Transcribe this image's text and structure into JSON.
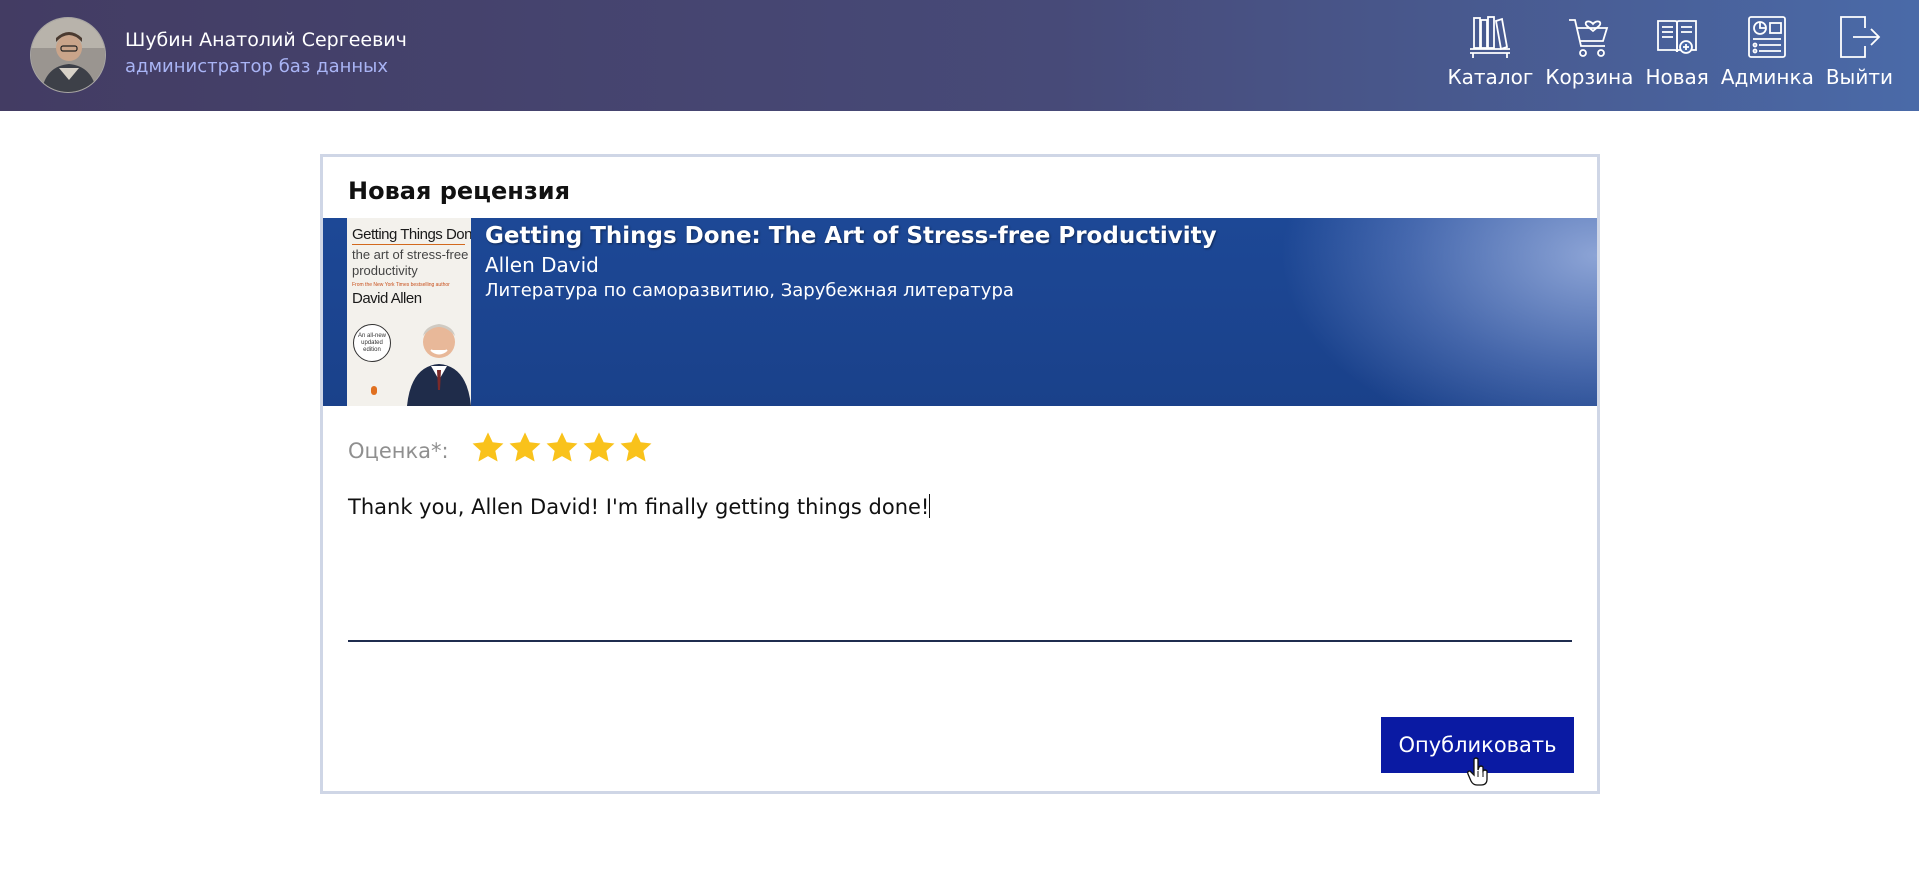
{
  "user": {
    "name": "Шубин Анатолий Сергеевич",
    "role": "администратор баз данных"
  },
  "nav": [
    {
      "label": "Каталог",
      "icon": "bookshelf-icon"
    },
    {
      "label": "Корзина",
      "icon": "cart-icon"
    },
    {
      "label": "Новая",
      "icon": "new-book-icon"
    },
    {
      "label": "Админка",
      "icon": "dashboard-icon"
    },
    {
      "label": "Выйти",
      "icon": "logout-icon"
    }
  ],
  "review_form": {
    "title": "Новая рецензия",
    "book": {
      "title": "Getting Things Done: The Art of Stress-free Productivity",
      "author": "Allen David",
      "genres": "Литература по саморазвитию, Зарубежная литература",
      "cover": {
        "line1": "Getting Things Done",
        "line2": "the art of stress-free",
        "line3": "productivity",
        "line4": "From the New York Times bestselling author",
        "line5": "David Allen",
        "badge": "An all-new updated edition"
      }
    },
    "rating_label": "Оценка*:",
    "rating": 5,
    "rating_max": 5,
    "review_text": "Thank you, Allen David! I'm finally getting things done!",
    "publish_label": "Опубликовать"
  },
  "colors": {
    "header_start": "#433c63",
    "header_end": "#4a6aa8",
    "banner": "#1d4896",
    "star": "#f9c21b",
    "button": "#0a1aa3",
    "role_text": "#a9b4f5"
  }
}
